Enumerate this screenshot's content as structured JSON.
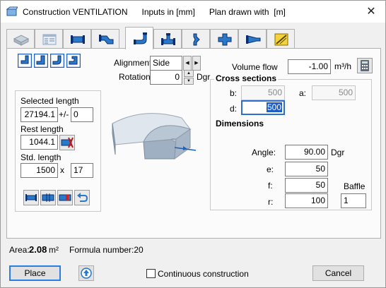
{
  "window": {
    "title": "Construction VENTILATION      Inputs in [mm]      Plan drawn with  [m]",
    "close_glyph": "✕"
  },
  "tabs": [
    {
      "icon": "iso-duct-icon"
    },
    {
      "icon": "table-icon"
    },
    {
      "icon": "straight-duct-icon"
    },
    {
      "icon": "offset-duct-icon"
    },
    {
      "icon": "bend-duct-icon",
      "active": true
    },
    {
      "icon": "tee-duct-icon"
    },
    {
      "icon": "reducer-duct-icon"
    },
    {
      "icon": "cross-duct-icon"
    },
    {
      "icon": "transition-duct-icon"
    },
    {
      "icon": "diagonal-duct-icon"
    }
  ],
  "alignment": {
    "label": "Alignment",
    "value": "Side"
  },
  "rotation": {
    "label": "Rotation",
    "value": "0",
    "unit": "Dgr"
  },
  "length_group": {
    "selected_label": "Selected length",
    "selected_value": "27194.1",
    "tolerance_sign": "+/-",
    "tolerance_value": "0",
    "rest_label": "Rest length",
    "rest_value": "1044.1",
    "std_label": "Std. length",
    "std_value": "1500",
    "times": "x",
    "std_count": "17"
  },
  "volume_flow": {
    "label": "Volume flow",
    "value": "-1.00",
    "unit": "m³/h"
  },
  "cross_sections": {
    "title": "Cross sections",
    "b_label": "b:",
    "b_value": "500",
    "a_label": "a:",
    "a_value": "500",
    "d_label": "d:",
    "d_value": "500"
  },
  "dimensions": {
    "title": "Dimensions",
    "angle_label": "Angle:",
    "angle_value": "90.00",
    "angle_unit": "Dgr",
    "e_label": "e:",
    "e_value": "50",
    "f_label": "f:",
    "f_value": "50",
    "r_label": "r:",
    "r_value": "100",
    "baffle_label": "Baffle",
    "baffle_value": "1"
  },
  "area": {
    "label": "Area:",
    "value": "2.08",
    "unit": "m²"
  },
  "formula": {
    "label": "Formula number:20"
  },
  "buttons": {
    "place": "Place",
    "continuous": "Continuous construction",
    "cancel": "Cancel"
  },
  "colors": {
    "accent": "#1f5fc4",
    "icon_blue": "#2a78c8",
    "icon_dark": "#0a2d6e",
    "focus": "#2f6fd0"
  }
}
